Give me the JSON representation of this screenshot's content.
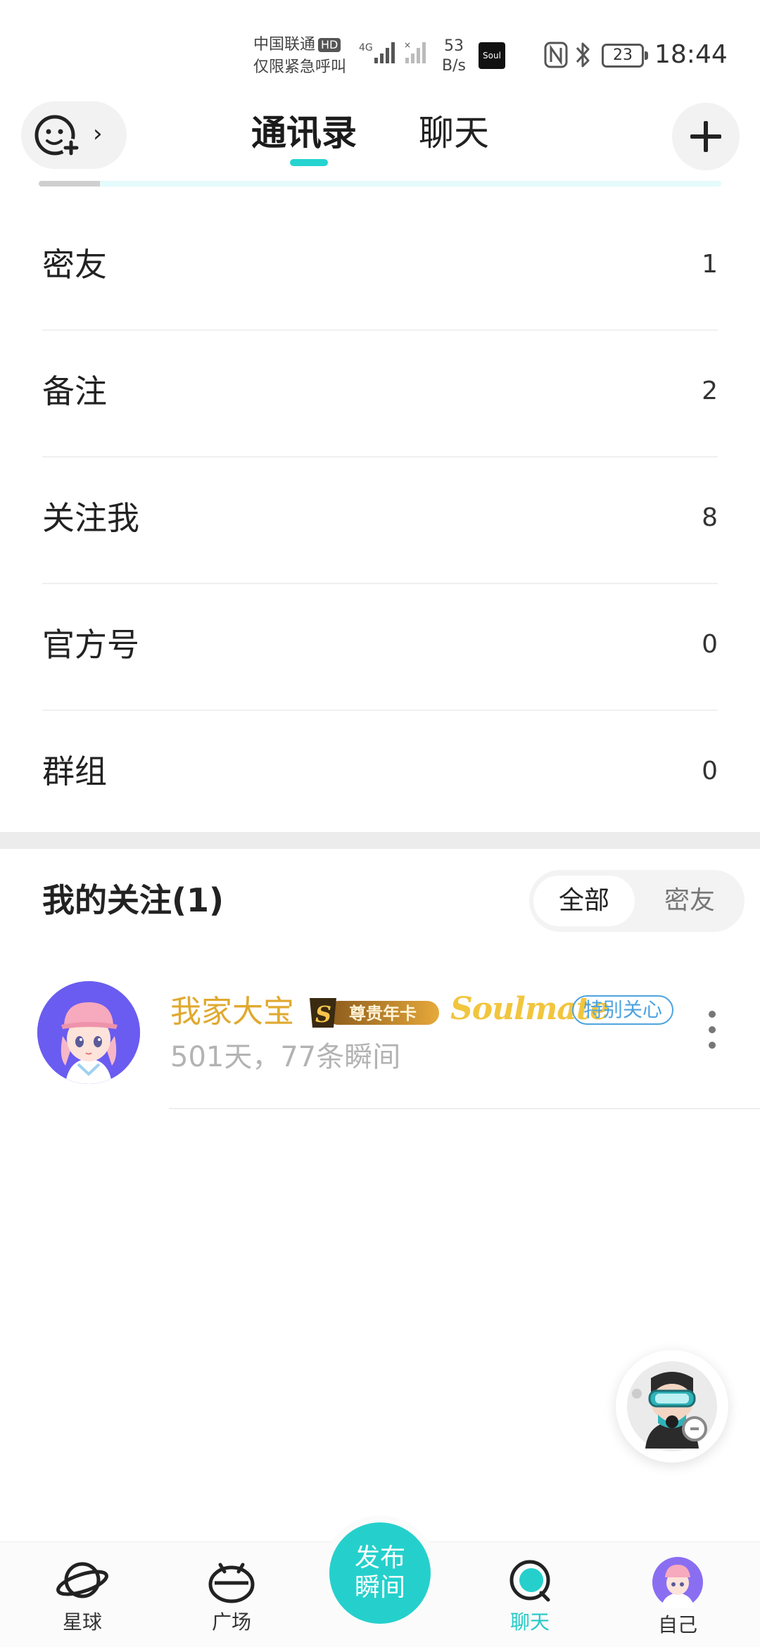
{
  "status_bar": {
    "carrier_line1": "中国联通",
    "carrier_badge": "HD",
    "carrier_line2": "仅限紧急呼叫",
    "network_type": "4G",
    "speed_value": "53",
    "speed_unit": "B/s",
    "app_icon_text": "Soul",
    "battery_level": "23",
    "time": "18:44"
  },
  "header": {
    "tabs": [
      {
        "label": "通讯录",
        "active": true
      },
      {
        "label": "聊天",
        "active": false
      }
    ],
    "chevron": "›"
  },
  "contact_categories": [
    {
      "label": "密友",
      "count": "1"
    },
    {
      "label": "备注",
      "count": "2"
    },
    {
      "label": "关注我",
      "count": "8"
    },
    {
      "label": "官方号",
      "count": "0"
    },
    {
      "label": "群组",
      "count": "0"
    }
  ],
  "following": {
    "title": "我的关注(1)",
    "filters": [
      {
        "label": "全部",
        "selected": true
      },
      {
        "label": "密友",
        "selected": false
      }
    ],
    "users": [
      {
        "name": "我家大宝",
        "vip_badge": "尊贵年卡",
        "vip_badge_letter": "S",
        "soulmate_tag": "Soulmate",
        "care_tag": "特别关心",
        "subtitle": "501天，77条瞬间"
      }
    ]
  },
  "bottom_nav": {
    "items": [
      {
        "label": "星球",
        "icon": "planet-icon",
        "active": false
      },
      {
        "label": "广场",
        "icon": "square-icon",
        "active": false
      },
      {
        "label": "聊天",
        "icon": "chat-icon",
        "active": true
      },
      {
        "label": "自己",
        "icon": "profile-avatar",
        "active": false
      }
    ],
    "publish_line1": "发布",
    "publish_line2": "瞬间"
  },
  "colors": {
    "accent": "#25d0cc",
    "username": "#e0a92f",
    "soulmate": "#f2c53d",
    "care_tag": "#4ea3e0"
  }
}
